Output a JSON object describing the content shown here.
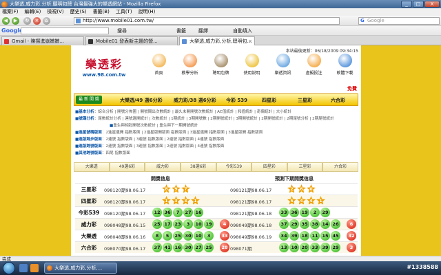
{
  "window": {
    "title": "大樂透,威力彩,分析,聽明包牌 台灣最強大的樂透網站 - Mozilla Firefox",
    "buttons": [
      "_",
      "□",
      "X"
    ]
  },
  "menubar": [
    "檔案(F)",
    "編輯(E)",
    "檢視(V)",
    "歷史(S)",
    "書籤(B)",
    "工具(T)",
    "說明(H)"
  ],
  "navbar": {
    "url": "http://www.mobile01.com.tw/",
    "search_placeholder": "Google"
  },
  "google_toolbar": {
    "logo": "Google",
    "items": [
      "搜尋",
      "書籤",
      "翻譯",
      "自動填入"
    ]
  },
  "tabs": [
    {
      "label": "Gmail - 陳揚進嶽嫩嫩...",
      "active": false
    },
    {
      "label": "Mobile01 發表新主題的營...",
      "active": false
    },
    {
      "label": "大樂透,威力彩,分析,聰明包...",
      "active": true
    }
  ],
  "page": {
    "last_updated": "本站最後更新：06/18/2009 09:34:15",
    "logo_text": "樂透彩",
    "logo_url": "www.98.com.tw",
    "free_label": "免費",
    "top_nav": [
      {
        "label": "首頁",
        "color": "#f0a020"
      },
      {
        "label": "教學分析",
        "color": "#f07818"
      },
      {
        "label": "聰明包牌",
        "color": "#8a6a3a"
      },
      {
        "label": "使用說明",
        "color": "#e8b000"
      },
      {
        "label": "樂透資訊",
        "color": "#3a8ad8"
      },
      {
        "label": "虛擬投注",
        "color": "#f09010"
      },
      {
        "label": "軟體下載",
        "color": "#2070d0"
      }
    ],
    "strip_tag": "最 新 開 獎",
    "strip_items": [
      "大樂透/49 選6分彩",
      "威力彩/38 選6分彩",
      "今彩 539",
      "四星彩",
      "三星彩",
      "六合彩"
    ],
    "links": [
      {
        "head": "基本分析",
        "text": "綜合分析 | 開號分佈圖 | 開號間出次數統計 | 最久未開開號次數統計 | AC值統計 | 和值統計 | 奇偶統計 | 大小統計"
      },
      {
        "head": "號碼分析",
        "text": "尾數統計分析 | 連號遺開統計 | 次數統計 | 1期統計 | 3期開號數 | 2期開號統計 | 3期開號統計 | 2期開號統計 | 2期尾號分析 | 2期尾號統計"
      },
      {
        "head": "",
        "text": "重生與相剋開號次數統計 | 重生與下一期開號統計"
      },
      {
        "head": "進星號碼版面",
        "text": "2進星遺開 指數版面 | 2進星版開版面 指數版面 | 3進星遺開 指數版面 | 3進星版開 指數版面"
      },
      {
        "head": "進版跨步版面",
        "text": "2連號 指數版面 | 3連號 指數版面 | 2連號 指數版面 | 4連號 指數版面"
      },
      {
        "head": "進版跨號版面",
        "text": "2連號 指數版面 | 3連號 指數版面 | 2連號 指數版面 | 4連號 指數版面"
      },
      {
        "head": "其他跨號版面",
        "text": "四尾 指數版面"
      }
    ],
    "game_tabs": [
      "大樂透",
      "49選6彩",
      "威力彩",
      "38選6彩",
      "今彩539",
      "四星彩",
      "三星彩",
      "六合彩"
    ],
    "results": {
      "left_header": "開獎信息",
      "right_header": "預測下期開獎信息",
      "rows": [
        {
          "game": "三星彩",
          "left_period": "098120期98.06.17",
          "left_balls": [
            "8",
            "9",
            "7"
          ],
          "left_special": null,
          "right_period": "098121期98.06.17",
          "right_balls": [
            "2",
            "6",
            "0"
          ],
          "right_special": null,
          "kind": "star"
        },
        {
          "game": "四星彩",
          "left_period": "098120期98.06.17",
          "left_balls": [
            "1",
            "3",
            "3",
            "1"
          ],
          "left_special": null,
          "right_period": "098121期98.06.17",
          "right_balls": [
            "5",
            "4",
            "4",
            "1"
          ],
          "right_special": null,
          "kind": "star"
        },
        {
          "game": "今彩539",
          "left_period": "098120期98.06.17",
          "left_balls": [
            "12",
            "36",
            "7",
            "27",
            "16"
          ],
          "left_special": null,
          "right_period": "098121期98.06.18",
          "right_balls": [
            "33",
            "36",
            "19",
            "2",
            "29"
          ],
          "right_special": null,
          "kind": "green"
        },
        {
          "game": "威力彩",
          "left_period": "098048期98.06.15",
          "left_balls": [
            "25",
            "17",
            "23",
            "3",
            "10",
            "19"
          ],
          "left_special": "4",
          "right_period": "098049期98.06.18",
          "right_balls": [
            "37",
            "29",
            "35",
            "38",
            "14",
            "26"
          ],
          "right_special": "6",
          "kind": "green"
        },
        {
          "game": "大樂透",
          "left_period": "098048期98.06.16",
          "left_balls": [
            "8",
            "5",
            "25",
            "30",
            "10",
            "3"
          ],
          "left_special": "33",
          "right_period": "098049期98.06.19",
          "right_balls": [
            "34",
            "39",
            "18",
            "11",
            "15",
            "45"
          ],
          "right_special": "32",
          "kind": "green"
        },
        {
          "game": "六合彩",
          "left_period": "098070期98.06.17",
          "left_balls": [
            "37",
            "41",
            "16",
            "30",
            "27",
            "25"
          ],
          "left_special": "28",
          "right_period": "098071期",
          "right_balls": [
            "13",
            "10",
            "20",
            "33",
            "39",
            "29"
          ],
          "right_special": "3",
          "kind": "green"
        }
      ]
    }
  },
  "status": "完成",
  "taskbar": {
    "window_label": "大樂透,威力彩,分析,...",
    "tray_text": "#1338588"
  }
}
